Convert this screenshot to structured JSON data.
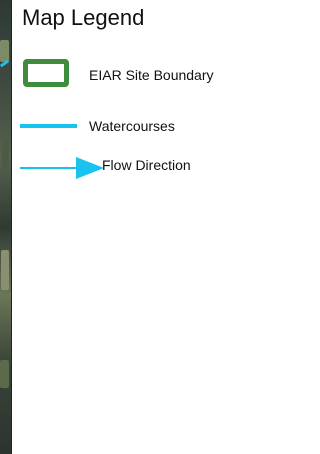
{
  "legend": {
    "title": "Map Legend",
    "items": [
      {
        "label": "EIAR Site Boundary",
        "symbol": "green-rounded-rectangle-outline",
        "color": "#3f8c3c"
      },
      {
        "label": "Watercourses",
        "symbol": "cyan-line",
        "color": "#19c3ef"
      },
      {
        "label": "Flow Direction",
        "symbol": "cyan-arrow",
        "color": "#19c3ef"
      }
    ]
  }
}
